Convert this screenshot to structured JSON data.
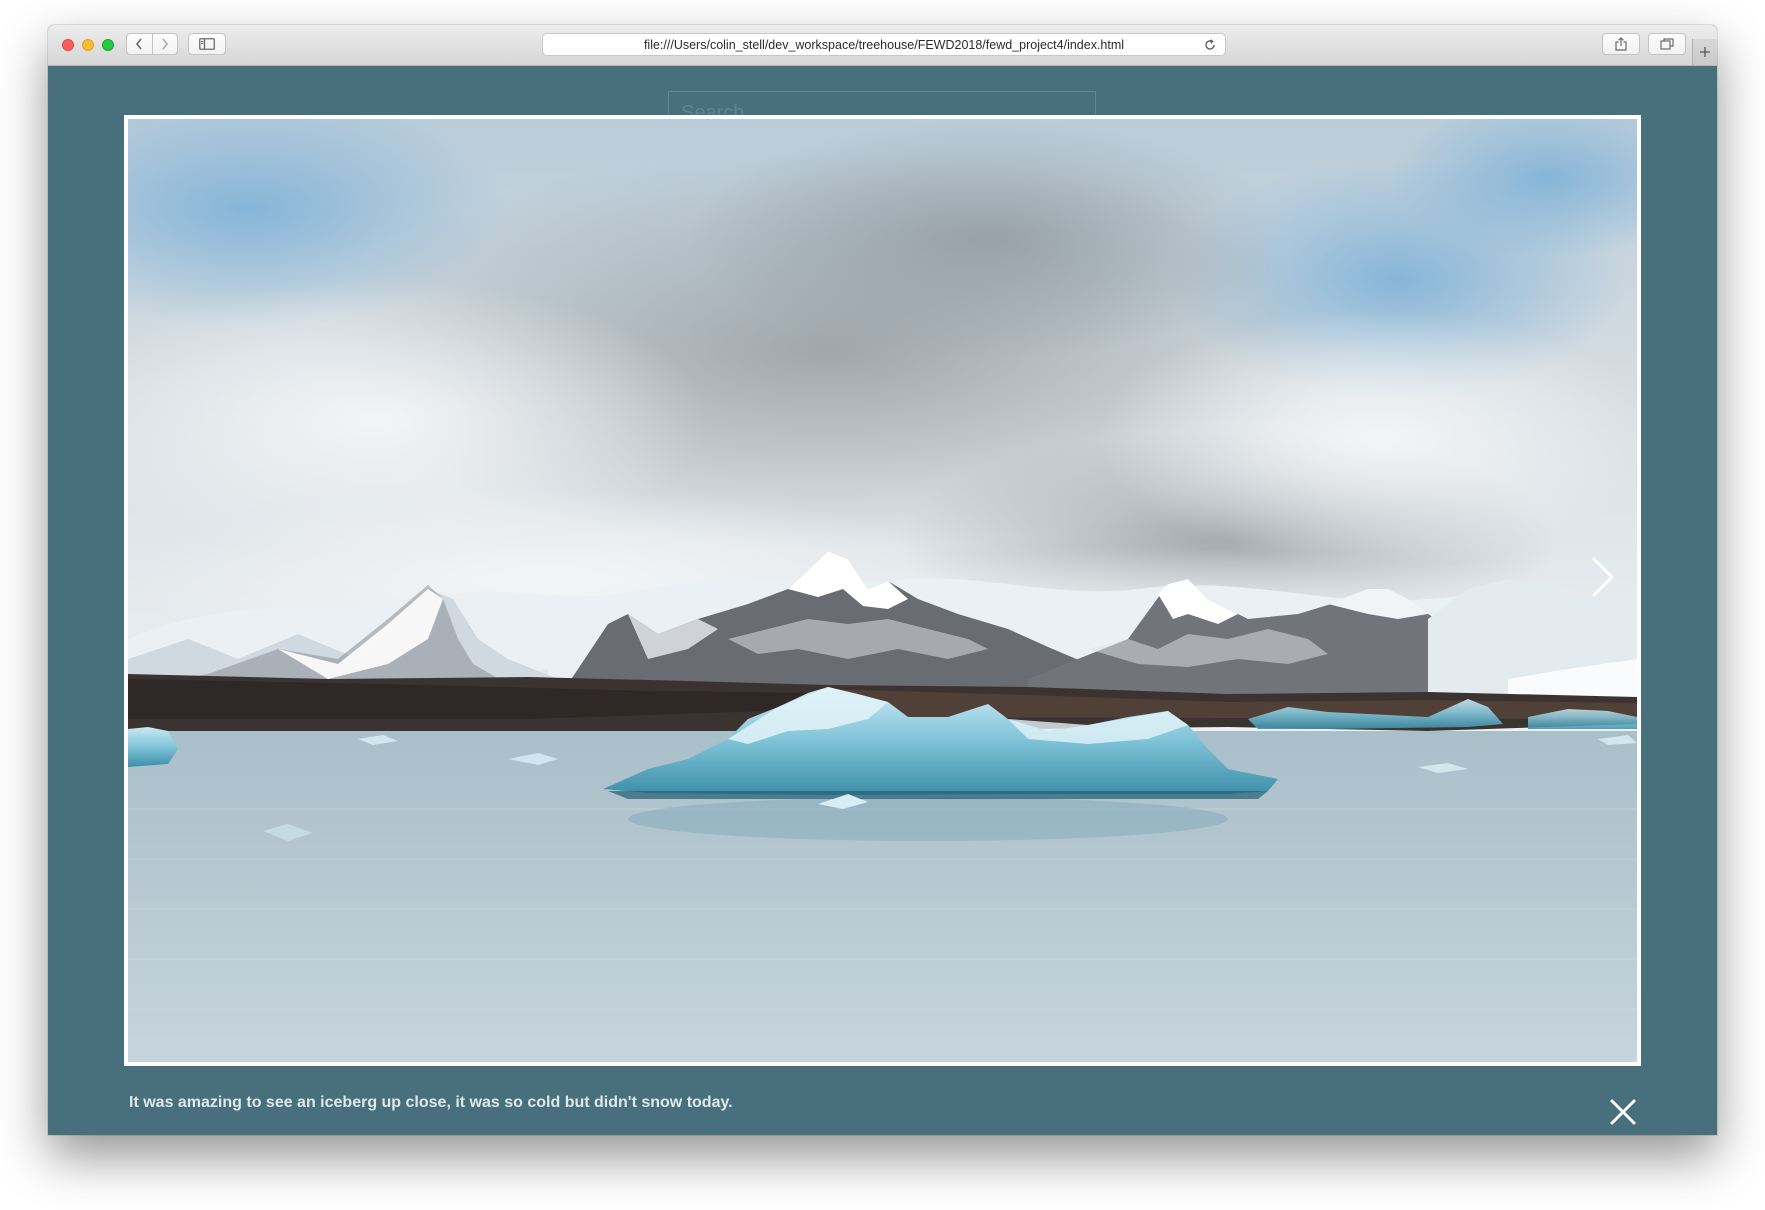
{
  "browser": {
    "url": "file:///Users/colin_stell/dev_workspace/treehouse/FEWD2018/fewd_project4/index.html",
    "icons": {
      "back": "chevron-left-icon",
      "forward": "chevron-right-icon",
      "sidebar": "sidebar-icon",
      "reload": "reload-icon",
      "share": "share-icon",
      "tabs": "tabs-overview-icon",
      "new_tab": "plus-icon"
    }
  },
  "page": {
    "background_color": "#47707c",
    "search_placeholder": "Search"
  },
  "lightbox": {
    "image_alt": "Icebergs floating in a glacier lagoon in front of snow-capped mountains under a cloudy sky",
    "caption": "It was amazing to see an iceberg up close, it was so cold but didn't snow today.",
    "next_icon": "chevron-right-icon",
    "close_icon": "close-icon"
  }
}
